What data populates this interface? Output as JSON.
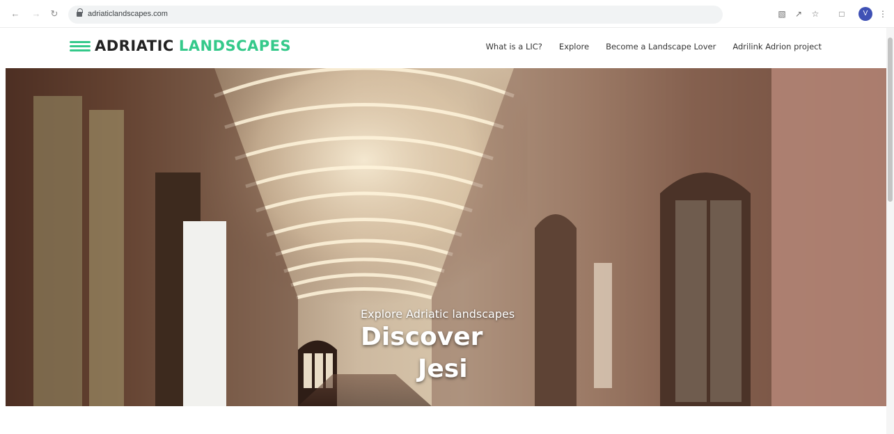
{
  "browser": {
    "url": "adriaticlandscapes.com",
    "icons": [
      "back-icon",
      "forward-icon",
      "reload-icon",
      "lock-icon",
      "translate-icon",
      "share-icon",
      "star-icon",
      "sidebar-icon",
      "profile-icon",
      "menu-icon"
    ],
    "profile_initial": "V",
    "profile_color": "#3f51b5"
  },
  "site": {
    "logo_part1": "ADRIATIC",
    "logo_part2": "LANDSCAPES",
    "accent_color": "#34c98a",
    "nav": [
      {
        "label": "What is a LIC?"
      },
      {
        "label": "Explore"
      },
      {
        "label": "Become a Landscape Lover"
      },
      {
        "label": "Adrilink Adrion project"
      }
    ]
  },
  "hero": {
    "subtitle": "Explore Adriatic landscapes",
    "title_line1": "Discover",
    "title_line2": "Jesi"
  }
}
